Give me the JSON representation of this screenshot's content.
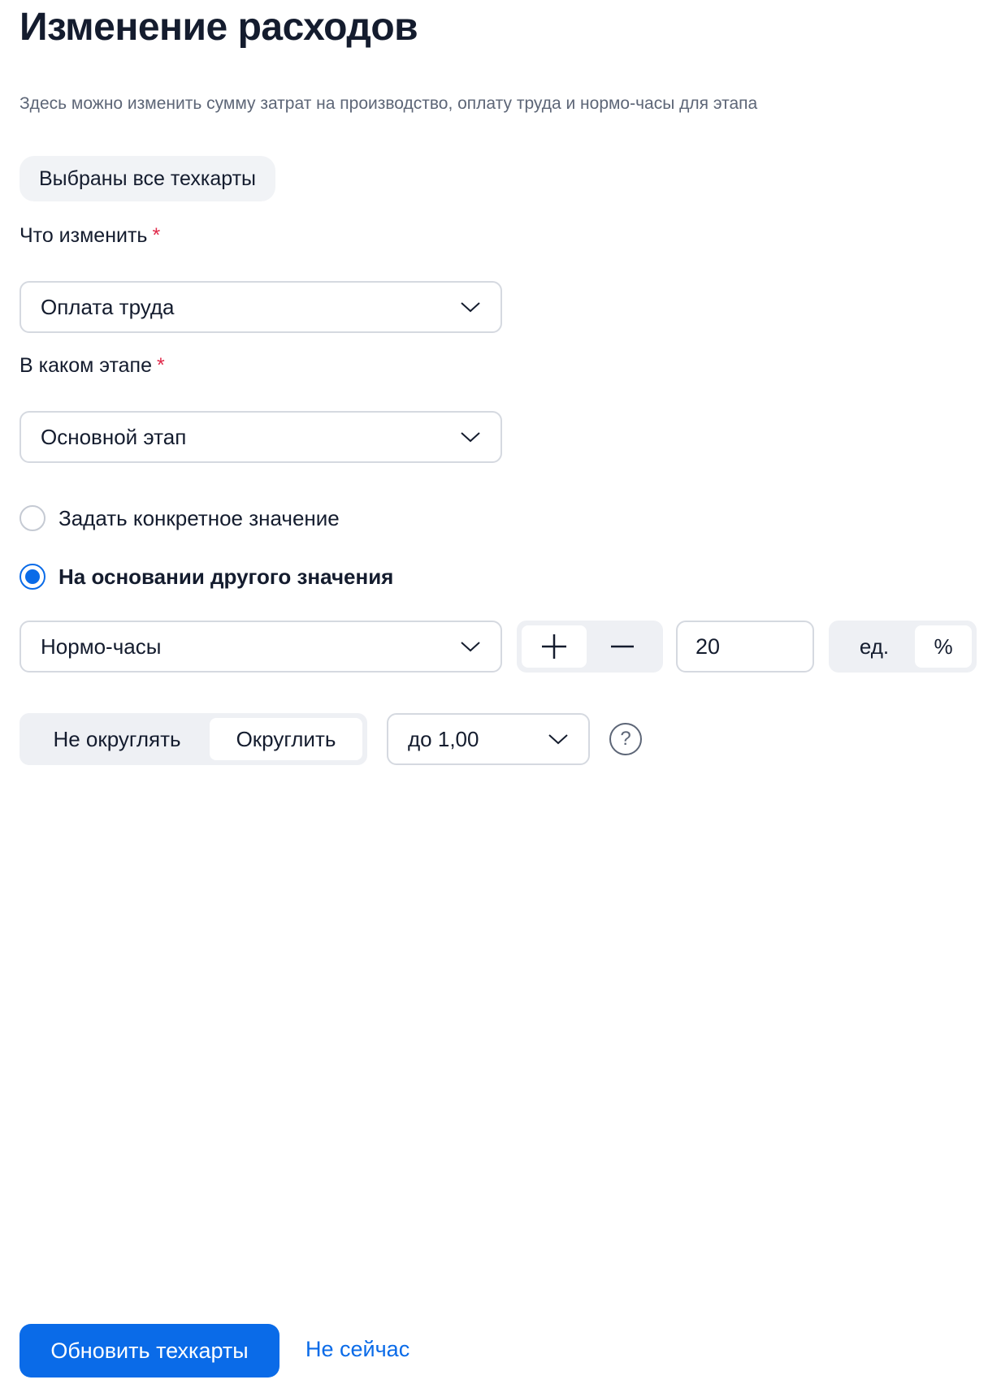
{
  "header": {
    "title": "Изменение расходов",
    "subtitle": "Здесь можно изменить сумму затрат на производство, оплату труда и нормо-часы для этапа"
  },
  "selection_chip": "Выбраны все техкарты",
  "what_to_change": {
    "label": "Что изменить",
    "required_mark": "*",
    "value": "Оплата труда",
    "icon": "chevron-down-icon"
  },
  "stage": {
    "label": "В каком этапе",
    "required_mark": "*",
    "value": "Основной этап",
    "icon": "chevron-down-icon"
  },
  "mode": {
    "options": [
      {
        "label": "Задать конкретное значение",
        "selected": false
      },
      {
        "label": "На основании другого значения",
        "selected": true
      }
    ]
  },
  "base_value": {
    "source": "Нормо-часы",
    "operations": [
      {
        "symbol": "+",
        "icon": "plus-icon",
        "active": true
      },
      {
        "symbol": "—",
        "icon": "minus-icon",
        "active": false
      }
    ],
    "amount": "20",
    "units": [
      {
        "label": "ед.",
        "active": false
      },
      {
        "label": "%",
        "active": true
      }
    ]
  },
  "rounding": {
    "options": [
      {
        "label": "Не округлять",
        "active": false
      },
      {
        "label": "Округлить",
        "active": true
      }
    ],
    "precision": "до 1,00",
    "help_icon": "question-circle-icon",
    "help_glyph": "?"
  },
  "footer": {
    "primary_label": "Обновить техкарты",
    "secondary_label": "Не сейчас"
  },
  "colors": {
    "accent": "#0a6be8",
    "required": "#e0294a",
    "text": "#141c2e",
    "muted": "#5d6677"
  }
}
